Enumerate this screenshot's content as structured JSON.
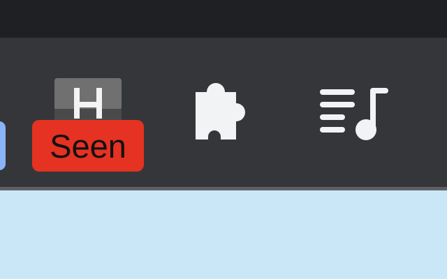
{
  "toolbar": {
    "extensions": [
      {
        "id": "seen-extension",
        "icon": "h-letter-icon",
        "badge_text": "Seen",
        "badge_color": "#e53222"
      },
      {
        "id": "extensions-menu",
        "icon": "puzzle-piece-icon"
      },
      {
        "id": "media-control",
        "icon": "playlist-music-icon"
      }
    ]
  },
  "colors": {
    "toolbar_background": "#35363a",
    "top_strip": "#1f2023",
    "page_background": "#c9e7f7",
    "left_edge_button": "#8ab4f8",
    "icon_foreground": "#f1f3f4"
  }
}
